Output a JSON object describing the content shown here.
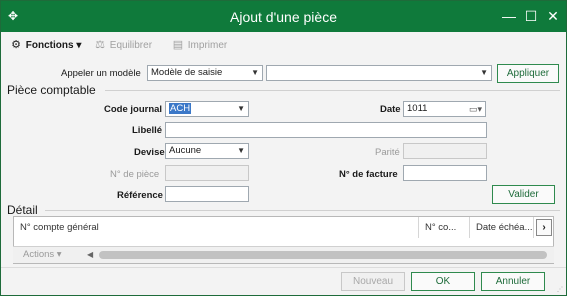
{
  "window": {
    "title": "Ajout d'une pièce",
    "controls": {
      "minimize": "—",
      "maximize": "☐",
      "close": "✕"
    }
  },
  "toolbar": {
    "fonctions": "Fonctions ▾",
    "equilibrer": "Equilibrer",
    "imprimer": "Imprimer"
  },
  "model": {
    "label": "Appeler un modèle",
    "type_value": "Modèle de saisie",
    "model_value": "",
    "apply_button": "Appliquer"
  },
  "piece": {
    "section_title": "Pièce comptable",
    "code_journal_label": "Code journal",
    "code_journal_value": "ACH",
    "date_label": "Date",
    "date_value": "1011",
    "libelle_label": "Libellé",
    "libelle_value": "",
    "devise_label": "Devise",
    "devise_value": "Aucune",
    "parite_label": "Parité",
    "parite_value": "",
    "num_piece_label": "N° de pièce",
    "num_piece_value": "",
    "num_facture_label": "N° de facture",
    "num_facture_value": "",
    "reference_label": "Référence",
    "reference_value": "",
    "validate_button": "Valider"
  },
  "detail": {
    "section_title": "Détail",
    "columns": [
      "N° compte général",
      "N° co...",
      "Date échéa..."
    ],
    "actions_label": "Actions ▾"
  },
  "footer": {
    "nouveau": "Nouveau",
    "ok": "OK",
    "annuler": "Annuler"
  },
  "colors": {
    "title_bar": "#0f7a3b",
    "accent_border": "#2f8a4e",
    "selection": "#3b78c8"
  }
}
